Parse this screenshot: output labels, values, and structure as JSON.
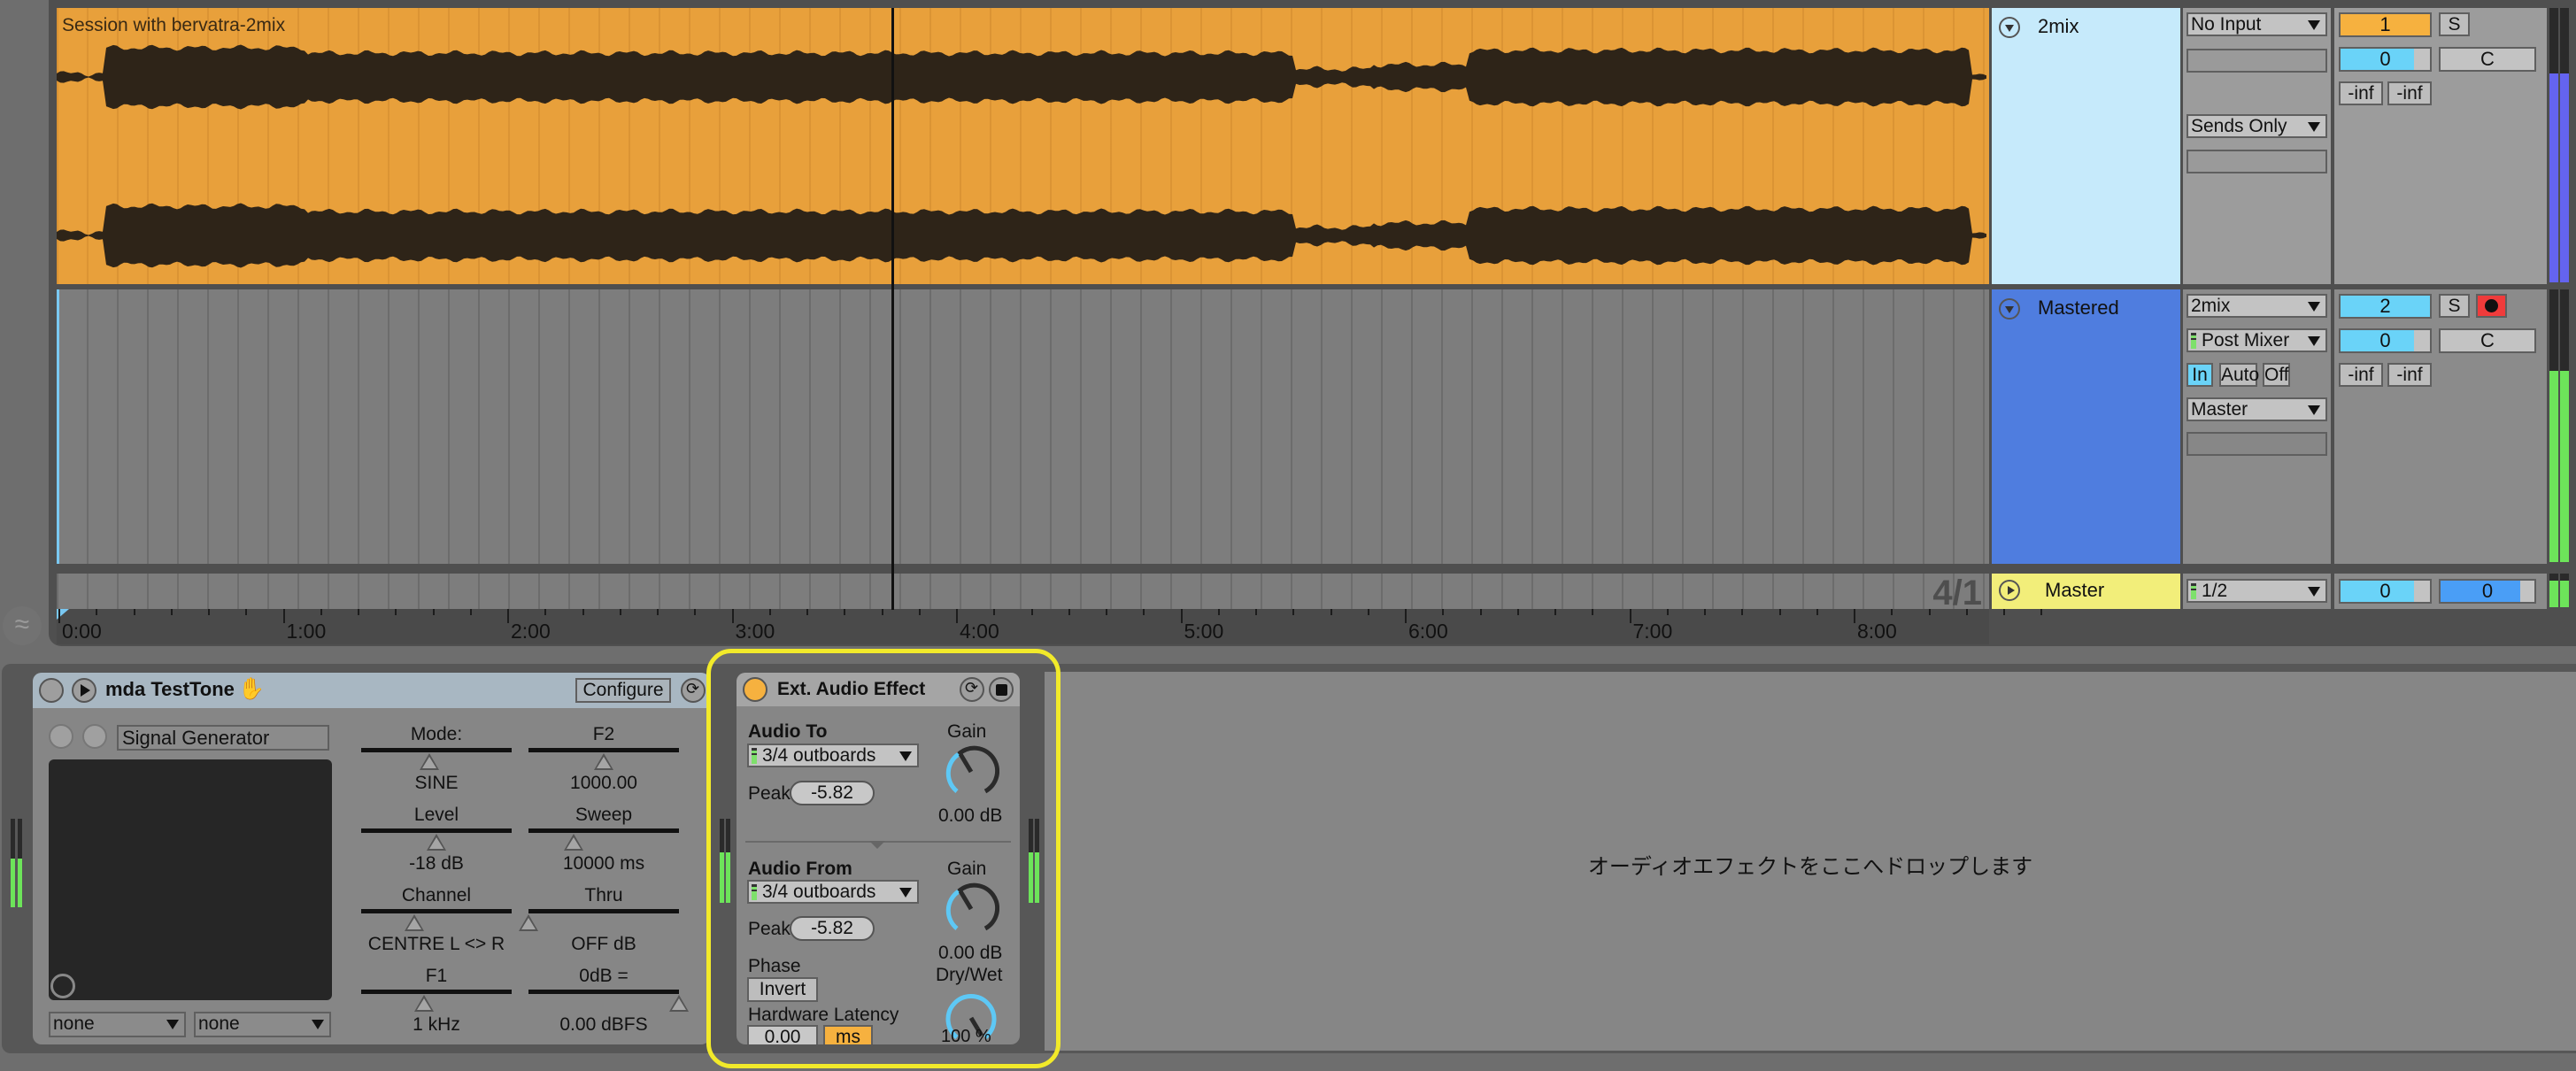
{
  "arrangement": {
    "clip": {
      "title": "Session with bervatra-2mix",
      "color": "#e8a03b"
    },
    "loop_ratio": "4/1",
    "playhead_time": "3:37",
    "ruler": {
      "labels": [
        "0:00",
        "1:00",
        "2:00",
        "3:00",
        "4:00",
        "5:00",
        "6:00",
        "7:00",
        "8:00"
      ]
    }
  },
  "tracks": [
    {
      "name": "2mix",
      "color": "#c6eafb",
      "input_type": "No Input",
      "input_channel": "",
      "output_type": "Sends Only",
      "output_channel": "",
      "number": "1",
      "number_color": "#f6b13f",
      "solo_label": "S",
      "volume": "0",
      "pan": "C",
      "peak_left": "-inf",
      "peak_right": "-inf",
      "meter_color": "#6464f0",
      "meter_level": 0.76
    },
    {
      "name": "Mastered",
      "color": "#4f7ddf",
      "input_type": "2mix",
      "input_channel": "Post Mixer",
      "monitor": {
        "options": [
          "In",
          "Auto",
          "Off"
        ],
        "active": "In"
      },
      "output_type": "Master",
      "output_channel": "",
      "number": "2",
      "number_color": "#6ad3f8",
      "solo_label": "S",
      "arm": true,
      "volume": "0",
      "pan": "C",
      "peak_left": "-inf",
      "peak_right": "-inf",
      "meter_color": "#6de45a",
      "meter_level": 0.7
    },
    {
      "name": "Master",
      "color": "#f2ee7a",
      "output_channel": "1/2",
      "volume": "0",
      "cue_volume": "0"
    }
  ],
  "devices": {
    "testtone": {
      "title": "mda TestTone",
      "configure_label": "Configure",
      "preset_name": "Signal Generator",
      "xy_x_select": "none",
      "xy_y_select": "none",
      "params": [
        {
          "label": "Mode:",
          "value": "SINE",
          "position": 0.45
        },
        {
          "label": "F2",
          "value": "1000.00",
          "position": 0.5
        },
        {
          "label": "Level",
          "value": "-18 dB",
          "position": 0.5
        },
        {
          "label": "Sweep",
          "value": "10000 ms",
          "position": 0.3
        },
        {
          "label": "Channel",
          "value": "CENTRE L <> R",
          "position": 0.35
        },
        {
          "label": "Thru",
          "value": "OFF dB",
          "position": 0.0
        },
        {
          "label": "F1",
          "value": "1 kHz",
          "position": 0.42
        },
        {
          "label": "0dB =",
          "value": "0.00 dBFS",
          "position": 1.0
        }
      ]
    },
    "ext_audio": {
      "title": "Ext. Audio Effect",
      "audio_to_label": "Audio To",
      "audio_to_value": "3/4 outboards",
      "peak_label": "Peak",
      "audio_to_peak": "-5.82",
      "gain_label": "Gain",
      "gain_to_value": "0.00 dB",
      "audio_from_label": "Audio From",
      "audio_from_value": "3/4 outboards",
      "audio_from_peak": "-5.82",
      "gain_from_value": "0.00 dB",
      "phase_label": "Phase",
      "invert_label": "Invert",
      "drywet_label": "Dry/Wet",
      "drywet_value": "100 %",
      "latency_label": "Hardware Latency",
      "latency_value": "0.00",
      "latency_unit": "ms"
    },
    "drop_hint": "オーディオエフェクトをここへドロップします"
  }
}
